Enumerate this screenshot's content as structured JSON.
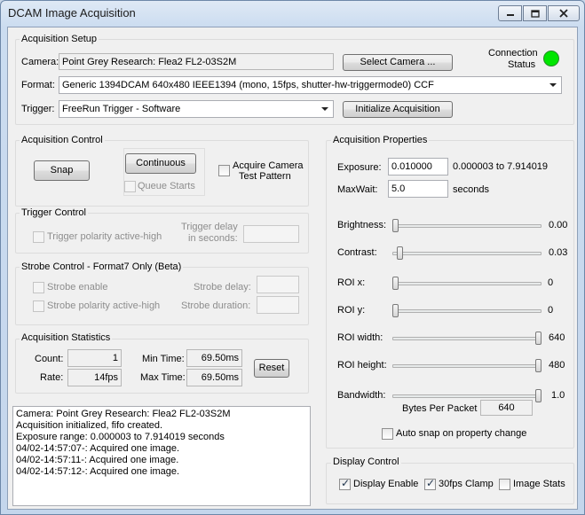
{
  "window": {
    "title": "DCAM Image Acquisition"
  },
  "setup": {
    "group_title": "Acquisition Setup",
    "camera_label": "Camera:",
    "camera_value": "Point Grey Research: Flea2 FL2-03S2M",
    "select_camera_label": "Select Camera ...",
    "connection_label_1": "Connection",
    "connection_label_2": "Status",
    "connection_color": "#00e600",
    "format_label": "Format:",
    "format_value": "Generic 1394DCAM 640x480 IEEE1394 (mono, 15fps, shutter-hw-triggermode0) CCF",
    "trigger_label": "Trigger:",
    "trigger_value": "FreeRun Trigger - Software",
    "initialize_label": "Initialize Acquisition"
  },
  "control": {
    "group_title": "Acquisition Control",
    "snap_label": "Snap",
    "continuous_label": "Continuous",
    "queue_starts_label": "Queue Starts",
    "test_pattern_label_1": "Acquire Camera",
    "test_pattern_label_2": "Test Pattern"
  },
  "trigger_control": {
    "group_title": "Trigger Control",
    "polarity_label": "Trigger polarity active-high",
    "delay_label_1": "Trigger delay",
    "delay_label_2": "in seconds:"
  },
  "strobe_control": {
    "group_title": "Strobe Control - Format7 Only (Beta)",
    "enable_label": "Strobe enable",
    "polarity_label": "Strobe polarity active-high",
    "delay_label": "Strobe delay:",
    "duration_label": "Strobe duration:"
  },
  "statistics": {
    "group_title": "Acquisition Statistics",
    "count_label": "Count:",
    "count_value": "1",
    "rate_label": "Rate:",
    "rate_value": "14fps",
    "min_time_label": "Min Time:",
    "min_time_value": "69.50ms",
    "max_time_label": "Max Time:",
    "max_time_value": "69.50ms",
    "reset_label": "Reset"
  },
  "log": {
    "lines": [
      "Camera: Point Grey Research: Flea2 FL2-03S2M",
      "Acquisition initialized, fifo created.",
      "Exposure range: 0.000003 to 7.914019 seconds",
      "04/02-14:57:07-: Acquired one image.",
      "04/02-14:57:11-: Acquired one image.",
      "04/02-14:57:12-: Acquired one image."
    ]
  },
  "properties": {
    "group_title": "Acquisition Properties",
    "exposure_label": "Exposure:",
    "exposure_value": "0.010000",
    "exposure_range": "0.000003 to 7.914019",
    "maxwait_label": "MaxWait:",
    "maxwait_value": "5.0",
    "maxwait_unit": "seconds",
    "sliders": [
      {
        "label": "Brightness:",
        "value": "0.00",
        "fraction": 0.0
      },
      {
        "label": "Contrast:",
        "value": "0.03",
        "fraction": 0.03
      },
      {
        "label": "ROI x:",
        "value": "0",
        "fraction": 0.0
      },
      {
        "label": "ROI y:",
        "value": "0",
        "fraction": 0.0
      },
      {
        "label": "ROI width:",
        "value": "640",
        "fraction": 1.0
      },
      {
        "label": "ROI height:",
        "value": "480",
        "fraction": 1.0
      },
      {
        "label": "Bandwidth:",
        "value": "1.0",
        "fraction": 1.0
      }
    ],
    "bytes_per_packet_label": "Bytes Per Packet",
    "bytes_per_packet_value": "640",
    "auto_snap_label": "Auto snap on property change"
  },
  "display": {
    "group_title": "Display Control",
    "display_enable_label": "Display Enable",
    "clamp_label": "30fps Clamp",
    "image_stats_label": "Image Stats"
  }
}
